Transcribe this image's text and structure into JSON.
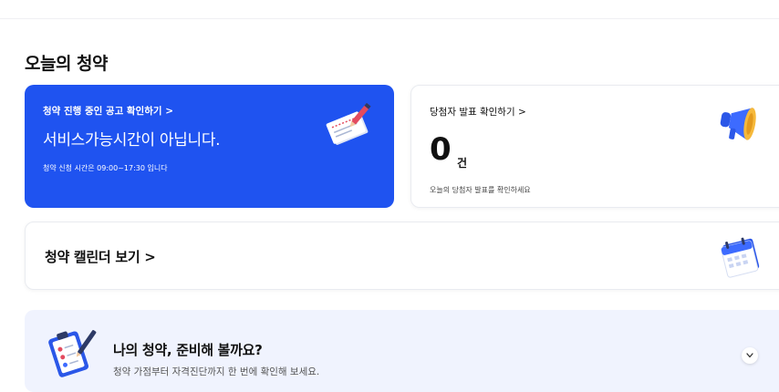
{
  "section": {
    "title": "오늘의 청약"
  },
  "active_card": {
    "link_label": "청약 진행 중인 공고 확인하기  >",
    "status_text": "서비스가능시간이 아닙니다.",
    "hours_text": "청약 신청 시간은 09:00~17:30 입니다",
    "icon": "document-pen-icon"
  },
  "winner_card": {
    "link_label": "당첨자 발표 확인하기  >",
    "count": "0",
    "unit": "건",
    "sub_text": "오늘의 당첨자 발표를 확인하세요",
    "icon": "megaphone-icon"
  },
  "calendar_card": {
    "label": "청약 캘린더 보기  >",
    "icon": "calendar-icon"
  },
  "prepare_banner": {
    "title": "나의 청약, 준비해 볼까요?",
    "description": "청약 가점부터 자격진단까지 한 번에 확인해 보세요.",
    "icon": "clipboard-check-icon",
    "toggle_icon": "chevron-down-icon"
  },
  "colors": {
    "accent": "#1f53f0",
    "banner_bg": "#f0f3fe"
  }
}
